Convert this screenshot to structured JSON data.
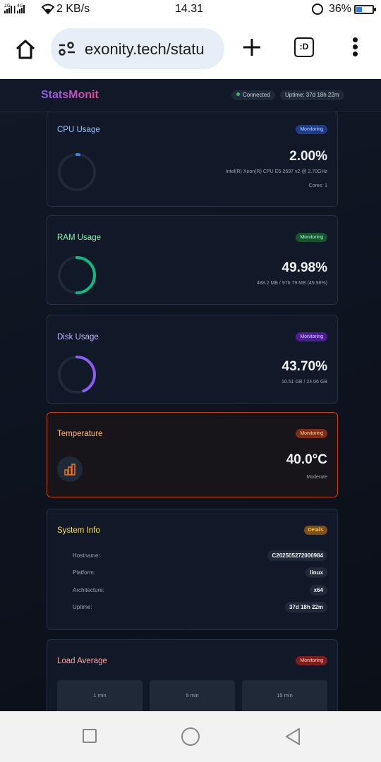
{
  "status_bar": {
    "network": "2G 4G",
    "speed": "2 KB/s",
    "time": "14.31",
    "battery": "36%",
    "battery_level": 0.36,
    "battery_color": "#2e7be8"
  },
  "browser": {
    "url": "exonity.tech/statu",
    "tabs_label": ":D",
    "icons": [
      "home-icon",
      "site-settings-icon",
      "plus-icon",
      "tabs-icon",
      "more-vert-icon"
    ]
  },
  "app": {
    "brand": "StatsMonit",
    "connection": "Connected",
    "uptime_pill": "Uptime: 37d 18h 22m"
  },
  "cards": {
    "cpu": {
      "title": "CPU Usage",
      "badge": "Monitoring",
      "value": "2.00%",
      "percent": 2.0,
      "model": "Intel(R) Xeon(R) CPU E5-2697 v2 @ 2.70GHz",
      "cores": "Cores: 1",
      "color": "#3b82f6"
    },
    "ram": {
      "title": "RAM Usage",
      "badge": "Monitoring",
      "value": "49.98%",
      "percent": 49.98,
      "detail": "488.2 MB / 976.79 MB (49.98%)",
      "color": "#10b981"
    },
    "disk": {
      "title": "Disk Usage",
      "badge": "Monitoring",
      "value": "43.70%",
      "percent": 43.7,
      "detail": "10.51 GB / 24.06 GB",
      "color": "#8b5cf6"
    },
    "temperature": {
      "title": "Temperature",
      "badge": "Monitoring",
      "value": "40.0°C",
      "status": "Moderate",
      "color": "#f97316"
    },
    "system_info": {
      "title": "System Info",
      "badge": "Details",
      "rows": [
        {
          "key": "Hostname:",
          "value": "C202505272000984"
        },
        {
          "key": "Platform:",
          "value": "linux"
        },
        {
          "key": "Architecture:",
          "value": "x64"
        },
        {
          "key": "Uptime:",
          "value": "37d 18h 22m"
        }
      ]
    },
    "load_average": {
      "title": "Load Average",
      "badge": "Monitoring",
      "periods": [
        "1 min",
        "5 min",
        "15 min"
      ]
    }
  },
  "nav_bar": {
    "icons": [
      "recents-icon",
      "home-circle-icon",
      "back-icon"
    ]
  }
}
